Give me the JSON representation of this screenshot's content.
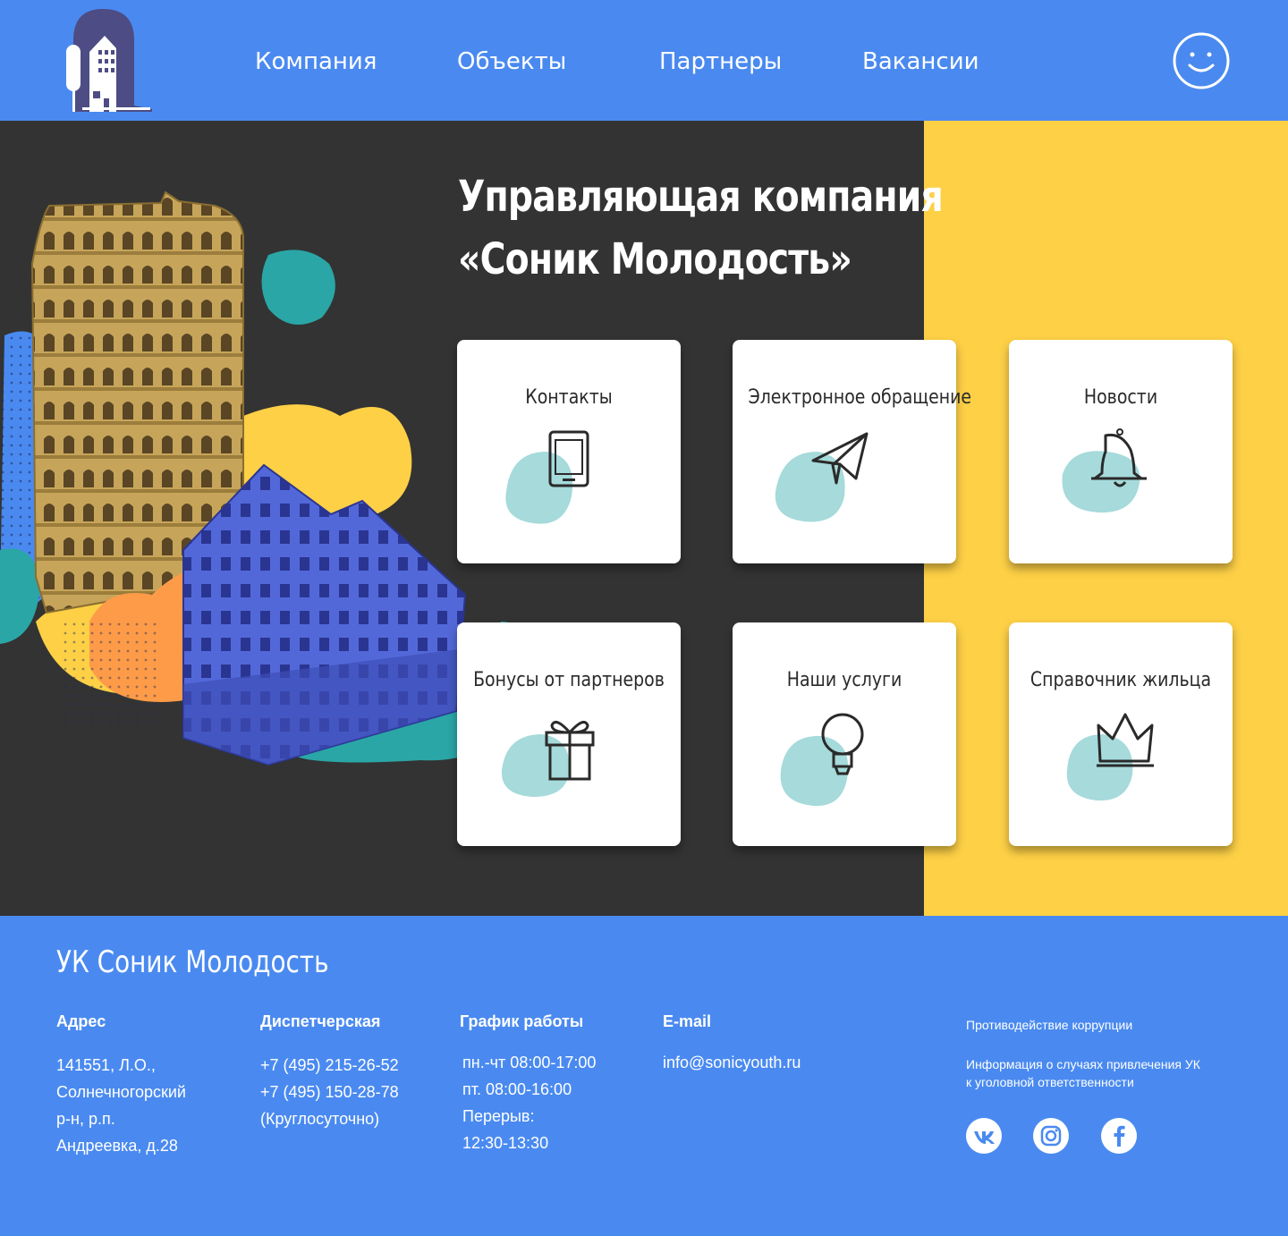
{
  "header": {
    "nav": [
      "Компания",
      "Объекты",
      "Партнеры",
      "Вакансии"
    ]
  },
  "hero": {
    "title_line1": "Управляющая компания",
    "title_line2": "«Соник Молодость»"
  },
  "cards": [
    {
      "label": "Контакты",
      "icon": "phone-icon"
    },
    {
      "label": "Электронное обращение",
      "icon": "paper-plane-icon"
    },
    {
      "label": "Новости",
      "icon": "bell-icon"
    },
    {
      "label": "Бонусы от партнеров",
      "icon": "gift-icon"
    },
    {
      "label": "Наши услуги",
      "icon": "lightbulb-icon"
    },
    {
      "label": "Справочник жильца",
      "icon": "crown-icon"
    }
  ],
  "footer": {
    "title": "УК Соник Молодость",
    "address_title": "Адрес",
    "address_lines": [
      "141551, Л.О.,",
      "Солнечногорский",
      "р-н, р.п.",
      "Андреевка, д.28"
    ],
    "dispatch_title": "Диспетчерская",
    "dispatch_lines": [
      "+7 (495) 215-26-52",
      "+7 (495) 150-28-78",
      "(Круглосуточно)"
    ],
    "schedule_title": "График работы",
    "schedule_lines": [
      "пн.-чт 08:00-17:00",
      "пт. 08:00-16:00",
      "Перерыв:",
      "12:30-13:30"
    ],
    "email_title": "E-mail",
    "email": "info@sonicyouth.ru",
    "anticorruption": "Противодействие коррупции",
    "info_line1": "Информация о случаях привлечения УК",
    "info_line2": "к уголовной ответственности"
  },
  "colors": {
    "brand_blue": "#4a8af0",
    "dark": "#333333",
    "yellow": "#fdd046",
    "teal_blob": "#a6dadb"
  }
}
